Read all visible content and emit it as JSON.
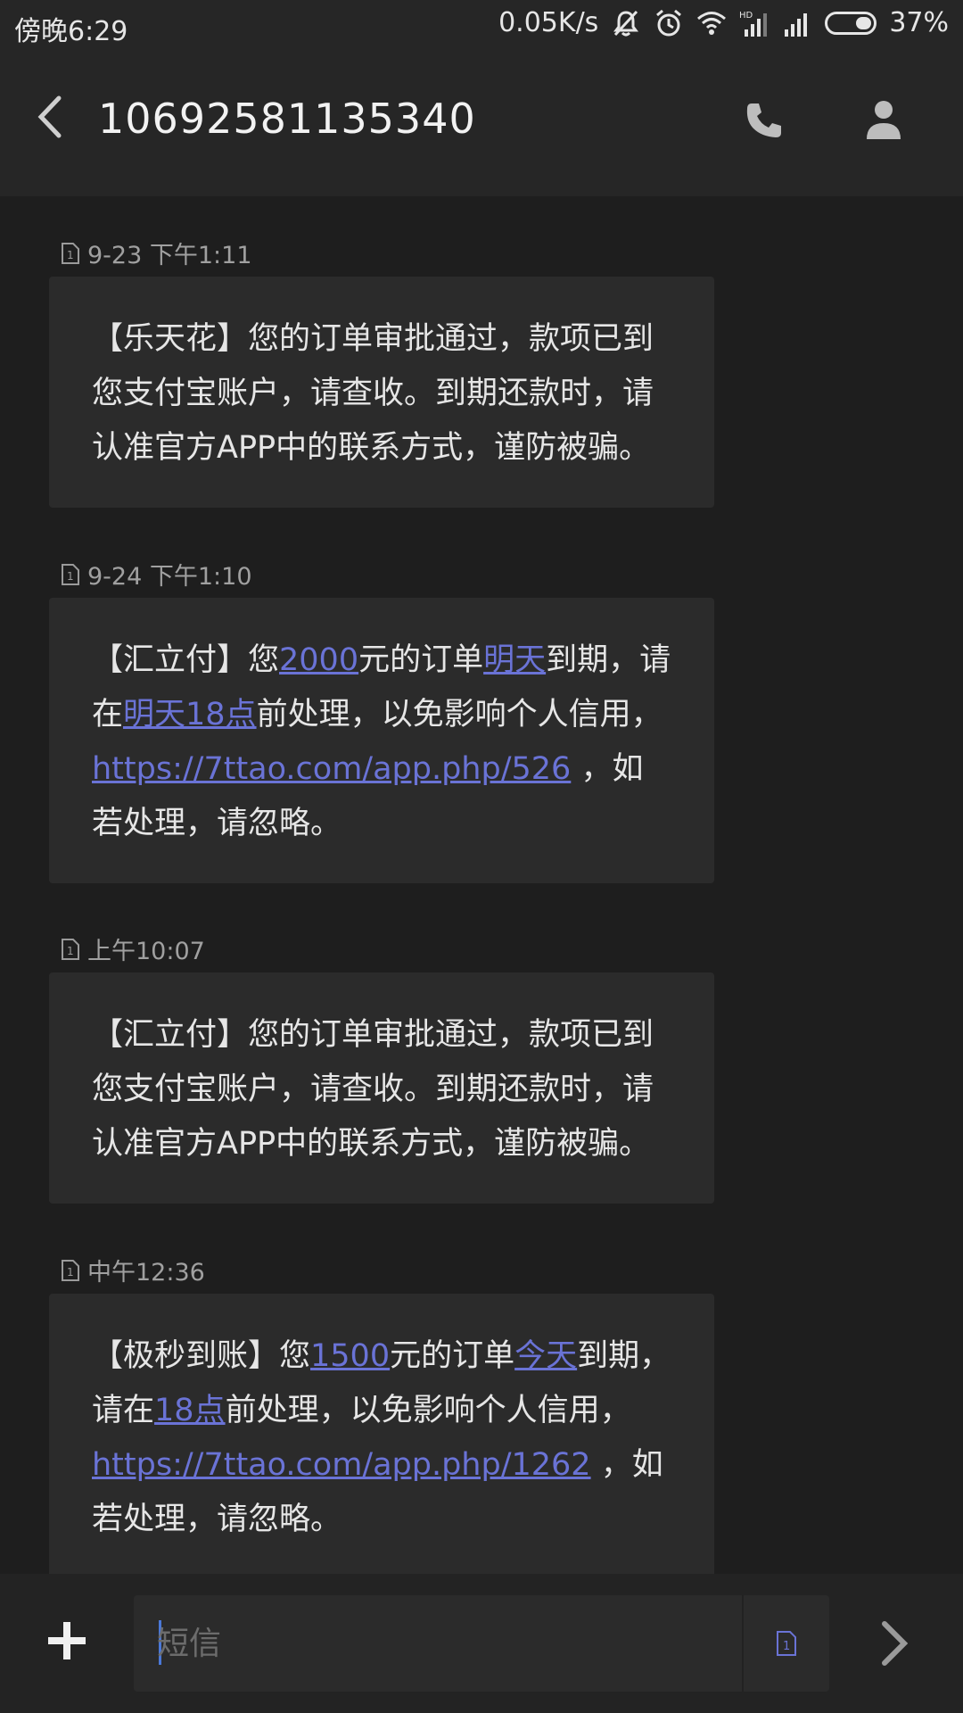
{
  "status_bar": {
    "time": "傍晚6:29",
    "network_speed": "0.05K/s",
    "battery_percent": "37%",
    "battery_level": 0.37,
    "icons": [
      "mute-icon",
      "alarm-icon",
      "wifi-icon",
      "hd-signal-icon",
      "signal-icon",
      "battery-icon"
    ]
  },
  "header": {
    "title": "10692581135340",
    "back_icon": "back-arrow-icon",
    "call_icon": "phone-icon",
    "contact_icon": "contact-icon"
  },
  "messages": [
    {
      "time": "9-23 下午1:11",
      "sim": "1",
      "parts": [
        {
          "text": "【乐天花】您的订单审批通过，款项已到您支付宝账户，请查收。到期还款时，请认准官方APP中的联系方式，谨防被骗。",
          "link": false
        }
      ]
    },
    {
      "time": "9-24 下午1:10",
      "sim": "1",
      "parts": [
        {
          "text": "【汇立付】您",
          "link": false
        },
        {
          "text": "2000",
          "link": true
        },
        {
          "text": "元的订单",
          "link": false
        },
        {
          "text": "明天",
          "link": true
        },
        {
          "text": "到期，请在",
          "link": false
        },
        {
          "text": "明天18点",
          "link": true
        },
        {
          "text": "前处理，以免影响个人信用，",
          "link": false
        },
        {
          "text": "https://7ttao.com/app.php/526",
          "link": true
        },
        {
          "text": " ，如若处理，请忽略。",
          "link": false
        }
      ]
    },
    {
      "time": "上午10:07",
      "sim": "1",
      "parts": [
        {
          "text": "【汇立付】您的订单审批通过，款项已到您支付宝账户，请查收。到期还款时，请认准官方APP中的联系方式，谨防被骗。",
          "link": false
        }
      ]
    },
    {
      "time": "中午12:36",
      "sim": "1",
      "parts": [
        {
          "text": "【极秒到账】您",
          "link": false
        },
        {
          "text": "1500",
          "link": true
        },
        {
          "text": "元的订单",
          "link": false
        },
        {
          "text": "今天",
          "link": true
        },
        {
          "text": "到期，请在",
          "link": false
        },
        {
          "text": "18点",
          "link": true
        },
        {
          "text": "前处理，以免影响个人信用，",
          "link": false
        },
        {
          "text": "https://7ttao.com/app.php/1262",
          "link": true
        },
        {
          "text": " ，如若处理，请忽略。",
          "link": false
        }
      ]
    }
  ],
  "composer": {
    "placeholder": "短信",
    "sim_label": "1",
    "add_icon": "plus-icon",
    "send_icon": "send-arrow-icon"
  },
  "colors": {
    "background": "#1e1e1e",
    "bar": "#262626",
    "bubble": "#2b2b2b",
    "link": "#6a73d6",
    "text": "#e6e6e6",
    "muted": "#a0a0a0"
  }
}
